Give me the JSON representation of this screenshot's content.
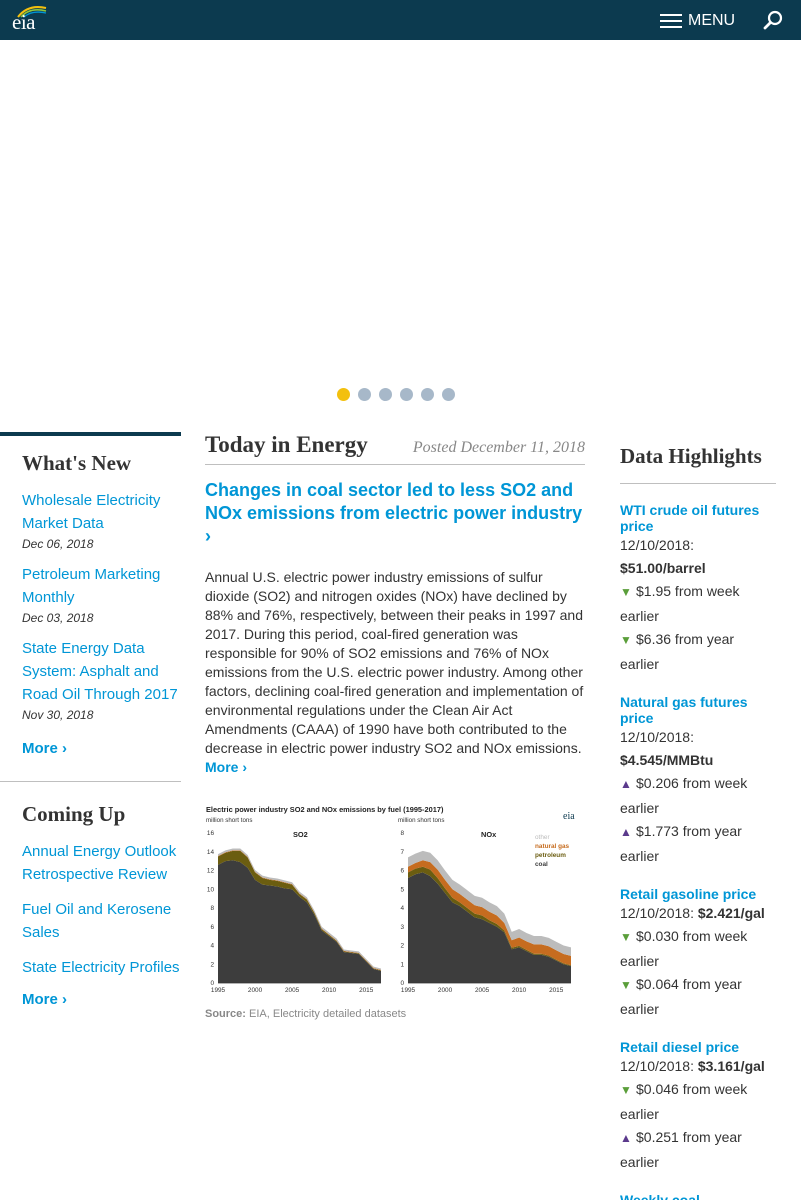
{
  "header": {
    "logo_text": "eia",
    "menu_label": "MENU",
    "icons": {
      "menu": "hamburger-icon",
      "search": "search-icon"
    }
  },
  "carousel": {
    "dots": 6,
    "active_index": 0,
    "colors": {
      "active": "#f3c00e",
      "inactive": "#a7b8c9"
    }
  },
  "whats_new": {
    "title": "What's New",
    "items": [
      {
        "label": "Wholesale Electricity Market Data",
        "date": "Dec 06, 2018"
      },
      {
        "label": "Petroleum Marketing Monthly",
        "date": "Dec 03, 2018"
      },
      {
        "label": "State Energy Data System: Asphalt and Road Oil Through 2017",
        "date": "Nov 30, 2018"
      }
    ],
    "more": "More ›"
  },
  "coming_up": {
    "title": "Coming Up",
    "items": [
      {
        "label": "Annual Energy Outlook Retrospective Review"
      },
      {
        "label": "Fuel Oil and Kerosene Sales"
      },
      {
        "label": "State Electricity Profiles"
      }
    ],
    "more": "More ›"
  },
  "today_in_energy": {
    "title": "Today in Energy",
    "posted": "Posted December 11, 2018",
    "headline": "Changes in coal sector led to less SO2 and NOx emissions from electric power industry ›",
    "summary": "Annual U.S. electric power industry emissions of sulfur dioxide (SO2) and nitrogen oxides (NOx) have declined by 88% and 76%, respectively, between their peaks in 1997 and 2017. During this period, coal-fired generation was responsible for 90% of SO2 emissions and 76% of NOx emissions from the U.S. electric power industry. Among other factors, declining coal-fired generation and implementation of environmental regulations under the Clean Air Act Amendments (CAAA) of 1990 have both contributed to the decrease in electric power industry SO2 and NOx emissions.",
    "more": "More ›",
    "source_label": "Source:",
    "source_text": "EIA, Electricity detailed datasets"
  },
  "data_highlights": {
    "title": "Data Highlights",
    "items": [
      {
        "label": "WTI crude oil futures price",
        "date": "12/10/2018:",
        "value": "$51.00/barrel",
        "changes": [
          {
            "dir": "down",
            "text": "$1.95 from week earlier"
          },
          {
            "dir": "down",
            "text": "$6.36 from year earlier"
          }
        ]
      },
      {
        "label": "Natural gas futures price",
        "date": "12/10/2018:",
        "value": "$4.545/MMBtu",
        "changes": [
          {
            "dir": "up",
            "text": "$0.206 from week earlier"
          },
          {
            "dir": "up",
            "text": "$1.773 from year earlier"
          }
        ]
      },
      {
        "label": "Retail gasoline price",
        "date": "12/10/2018:",
        "value": "$2.421/gal",
        "changes": [
          {
            "dir": "down",
            "text": "$0.030 from week earlier"
          },
          {
            "dir": "down",
            "text": "$0.064 from year earlier"
          }
        ]
      },
      {
        "label": "Retail diesel price",
        "date": "12/10/2018:",
        "value": "$3.161/gal",
        "changes": [
          {
            "dir": "down",
            "text": "$0.046 from week earlier"
          },
          {
            "dir": "up",
            "text": "$0.251 from year earlier"
          }
        ]
      },
      {
        "label": "Weekly coal"
      }
    ]
  },
  "chart_data": {
    "type": "area",
    "title": "Electric power industry SO2 and NOx emissions by fuel (1995-2017)",
    "colors": {
      "coal": "#3d3d3d",
      "petroleum": "#6b5d10",
      "natural_gas": "#c66c1f",
      "other": "#bcbcbc"
    },
    "x": [
      1995,
      1996,
      1997,
      1998,
      1999,
      2000,
      2001,
      2002,
      2003,
      2004,
      2005,
      2006,
      2007,
      2008,
      2009,
      2010,
      2011,
      2012,
      2013,
      2014,
      2015,
      2016,
      2017
    ],
    "xticks": [
      "1995",
      "2000",
      "2005",
      "2010",
      "2015"
    ],
    "panels": [
      {
        "name": "SO2",
        "ylabel": "million short tons",
        "ymax": 16,
        "yticks": [
          "0",
          "2",
          "4",
          "6",
          "8",
          "10",
          "12",
          "14",
          "16"
        ],
        "series": [
          {
            "name": "coal",
            "values": [
              12.6,
              13.0,
              13.1,
              12.9,
              12.3,
              11.0,
              10.5,
              10.4,
              10.3,
              10.1,
              10.0,
              9.2,
              8.6,
              7.3,
              5.6,
              5.0,
              4.4,
              3.3,
              3.2,
              3.1,
              2.3,
              1.5,
              1.3
            ]
          },
          {
            "name": "petroleum",
            "values": [
              0.9,
              0.9,
              1.0,
              1.2,
              1.1,
              0.8,
              0.7,
              0.6,
              0.6,
              0.6,
              0.5,
              0.3,
              0.3,
              0.2,
              0.15,
              0.12,
              0.1,
              0.08,
              0.07,
              0.07,
              0.06,
              0.05,
              0.05
            ]
          },
          {
            "name": "natural gas",
            "values": [
              0.05,
              0.05,
              0.05,
              0.05,
              0.05,
              0.05,
              0.05,
              0.05,
              0.05,
              0.05,
              0.05,
              0.05,
              0.05,
              0.05,
              0.05,
              0.05,
              0.05,
              0.05,
              0.05,
              0.05,
              0.05,
              0.05,
              0.05
            ]
          },
          {
            "name": "other",
            "values": [
              0.2,
              0.2,
              0.2,
              0.2,
              0.2,
              0.2,
              0.2,
              0.2,
              0.2,
              0.2,
              0.2,
              0.2,
              0.2,
              0.2,
              0.2,
              0.2,
              0.2,
              0.15,
              0.15,
              0.15,
              0.15,
              0.15,
              0.15
            ]
          }
        ]
      },
      {
        "name": "NOx",
        "ylabel": "million short tons",
        "ymax": 8,
        "yticks": [
          "0",
          "1",
          "2",
          "3",
          "4",
          "5",
          "6",
          "7",
          "8"
        ],
        "series": [
          {
            "name": "coal",
            "values": [
              5.6,
              5.8,
              5.9,
              5.7,
              5.3,
              4.8,
              4.3,
              4.1,
              3.8,
              3.5,
              3.4,
              3.2,
              3.0,
              2.7,
              1.8,
              1.9,
              1.7,
              1.5,
              1.5,
              1.4,
              1.2,
              1.0,
              0.9
            ]
          },
          {
            "name": "petroleum",
            "values": [
              0.3,
              0.3,
              0.3,
              0.35,
              0.3,
              0.25,
              0.25,
              0.2,
              0.2,
              0.2,
              0.2,
              0.15,
              0.15,
              0.1,
              0.08,
              0.08,
              0.07,
              0.06,
              0.06,
              0.06,
              0.05,
              0.05,
              0.05
            ]
          },
          {
            "name": "natural gas",
            "values": [
              0.3,
              0.3,
              0.35,
              0.4,
              0.45,
              0.45,
              0.45,
              0.45,
              0.45,
              0.45,
              0.45,
              0.45,
              0.45,
              0.4,
              0.4,
              0.45,
              0.45,
              0.5,
              0.5,
              0.5,
              0.5,
              0.5,
              0.5
            ]
          },
          {
            "name": "other",
            "values": [
              0.5,
              0.5,
              0.5,
              0.5,
              0.5,
              0.5,
              0.5,
              0.5,
              0.5,
              0.5,
              0.5,
              0.5,
              0.5,
              0.5,
              0.45,
              0.45,
              0.45,
              0.45,
              0.45,
              0.45,
              0.45,
              0.45,
              0.45
            ]
          }
        ]
      }
    ],
    "legend": [
      "other",
      "natural gas",
      "petroleum",
      "coal"
    ]
  }
}
